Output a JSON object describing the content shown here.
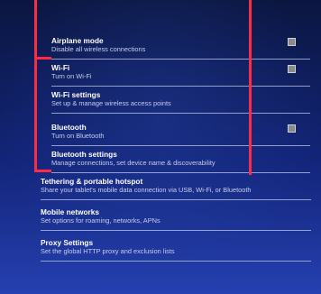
{
  "settings": {
    "items": [
      {
        "title": "Airplane mode",
        "summary": "Disable all wireless connections",
        "checkbox": true
      },
      {
        "title": "Wi-Fi",
        "summary": "Turn on Wi-Fi",
        "checkbox": true
      },
      {
        "title": "Wi-Fi settings",
        "summary": "Set up & manage wireless access points",
        "checkbox": false
      },
      {
        "title": "Bluetooth",
        "summary": "Turn on Bluetooth",
        "checkbox": true
      },
      {
        "title": "Bluetooth settings",
        "summary": "Manage connections, set device name & discoverability",
        "checkbox": false
      },
      {
        "title": "Tethering & portable hotspot",
        "summary": "Share your tablet's mobile data connection via USB, Wi-Fi, or Bluetooth",
        "checkbox": false
      },
      {
        "title": "Mobile networks",
        "summary": "Set options for roaming, networks, APNs",
        "checkbox": false
      },
      {
        "title": "Proxy Settings",
        "summary": "Set the global HTTP proxy and exclusion lists",
        "checkbox": false
      }
    ]
  },
  "colors": {
    "annotation": "#ff2a44",
    "background_top": "#0b1640",
    "background_bottom": "#2540b0"
  }
}
